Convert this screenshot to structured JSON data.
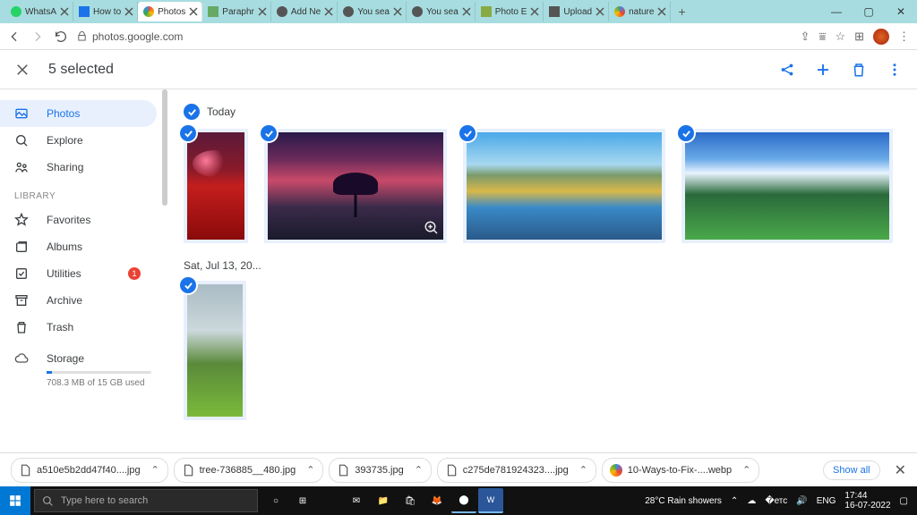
{
  "tabs": [
    {
      "label": "WhatsA"
    },
    {
      "label": "How to"
    },
    {
      "label": "Photos",
      "active": true
    },
    {
      "label": "Paraphr"
    },
    {
      "label": "Add Ne"
    },
    {
      "label": "You sea"
    },
    {
      "label": "You sea"
    },
    {
      "label": "Photo E"
    },
    {
      "label": "Upload"
    },
    {
      "label": "nature"
    }
  ],
  "url": "photos.google.com",
  "selection": {
    "title": "5 selected"
  },
  "sidebar": {
    "items": [
      {
        "label": "Photos"
      },
      {
        "label": "Explore"
      },
      {
        "label": "Sharing"
      }
    ],
    "library_label": "LIBRARY",
    "library": [
      {
        "label": "Favorites"
      },
      {
        "label": "Albums"
      },
      {
        "label": "Utilities",
        "badge": "1"
      },
      {
        "label": "Archive"
      },
      {
        "label": "Trash"
      }
    ],
    "storage": {
      "label": "Storage",
      "text": "708.3 MB of 15 GB used"
    }
  },
  "dates": {
    "today": "Today",
    "jul13": "Sat, Jul 13, 20..."
  },
  "downloads": [
    {
      "name": "a510e5b2dd47f40....jpg"
    },
    {
      "name": "tree-736885__480.jpg"
    },
    {
      "name": "393735.jpg"
    },
    {
      "name": "c275de781924323....jpg"
    },
    {
      "name": "10-Ways-to-Fix-....webp"
    }
  ],
  "showall": "Show all",
  "taskbar": {
    "search": "Type here to search",
    "weather": "28°C  Rain showers",
    "lang": "ENG",
    "time": "17:44",
    "date": "16-07-2022"
  }
}
